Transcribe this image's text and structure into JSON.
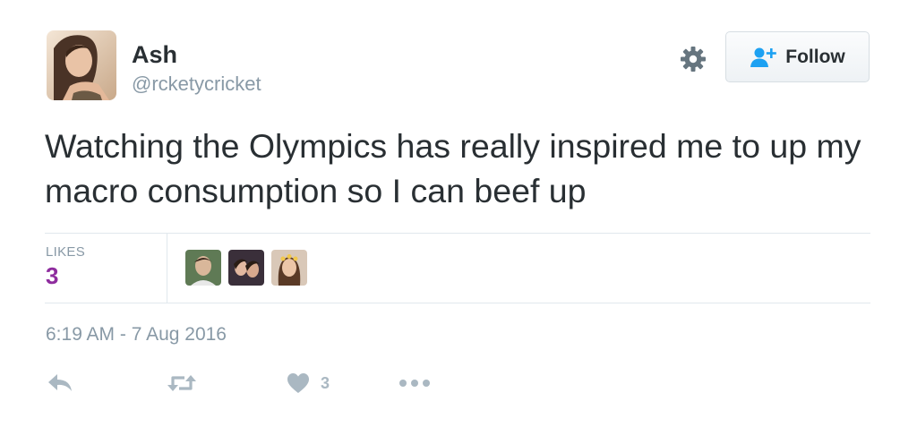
{
  "tweet": {
    "author_name": "Ash",
    "author_handle": "@rcketycricket",
    "text": "Watching the Olympics has really inspired me to up my macro consumption so I can beef up",
    "follow_label": "Follow",
    "likes_label": "LIKES",
    "likes_count": "3",
    "timestamp": "6:19 AM - 7 Aug 2016",
    "like_action_count": "3"
  },
  "icons": {
    "settings": "gear-icon",
    "follow": "follow-user-plus-icon",
    "reply": "reply-icon",
    "retweet": "retweet-icon",
    "like": "heart-icon",
    "more": "more-dots-icon"
  },
  "colors": {
    "accent_blue": "#1da1f2",
    "likes_count": "#8e2c9e",
    "muted": "#8899a6",
    "action_gray": "#aab8c2"
  }
}
